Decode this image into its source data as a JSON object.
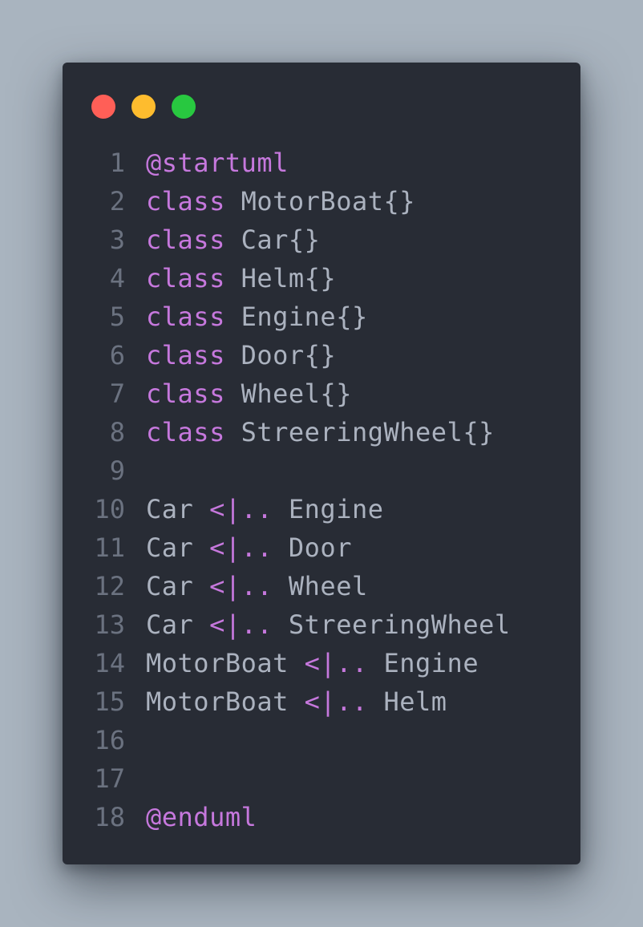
{
  "window": {
    "controls": {
      "close_color": "#ff5f57",
      "minimize_color": "#febc2e",
      "maximize_color": "#28c840"
    }
  },
  "theme": {
    "background": "#282c35",
    "keyword_color": "#c678dd",
    "identifier_color": "#abb2bf",
    "line_number_color": "#6b7280"
  },
  "code": {
    "lines": [
      {
        "number": "1",
        "tokens": [
          {
            "t": "@startuml",
            "c": "kw"
          }
        ]
      },
      {
        "number": "2",
        "tokens": [
          {
            "t": "class",
            "c": "kw"
          },
          {
            "t": " MotorBoat{}",
            "c": "id"
          }
        ]
      },
      {
        "number": "3",
        "tokens": [
          {
            "t": "class",
            "c": "kw"
          },
          {
            "t": " Car{}",
            "c": "id"
          }
        ]
      },
      {
        "number": "4",
        "tokens": [
          {
            "t": "class",
            "c": "kw"
          },
          {
            "t": " Helm{}",
            "c": "id"
          }
        ]
      },
      {
        "number": "5",
        "tokens": [
          {
            "t": "class",
            "c": "kw"
          },
          {
            "t": " Engine{}",
            "c": "id"
          }
        ]
      },
      {
        "number": "6",
        "tokens": [
          {
            "t": "class",
            "c": "kw"
          },
          {
            "t": " Door{}",
            "c": "id"
          }
        ]
      },
      {
        "number": "7",
        "tokens": [
          {
            "t": "class",
            "c": "kw"
          },
          {
            "t": " Wheel{}",
            "c": "id"
          }
        ]
      },
      {
        "number": "8",
        "tokens": [
          {
            "t": "class",
            "c": "kw"
          },
          {
            "t": " StreeringWheel{}",
            "c": "id"
          }
        ]
      },
      {
        "number": "9",
        "tokens": []
      },
      {
        "number": "10",
        "tokens": [
          {
            "t": "Car ",
            "c": "id"
          },
          {
            "t": "<|..",
            "c": "op"
          },
          {
            "t": " Engine",
            "c": "id"
          }
        ]
      },
      {
        "number": "11",
        "tokens": [
          {
            "t": "Car ",
            "c": "id"
          },
          {
            "t": "<|..",
            "c": "op"
          },
          {
            "t": " Door",
            "c": "id"
          }
        ]
      },
      {
        "number": "12",
        "tokens": [
          {
            "t": "Car ",
            "c": "id"
          },
          {
            "t": "<|..",
            "c": "op"
          },
          {
            "t": " Wheel",
            "c": "id"
          }
        ]
      },
      {
        "number": "13",
        "tokens": [
          {
            "t": "Car ",
            "c": "id"
          },
          {
            "t": "<|..",
            "c": "op"
          },
          {
            "t": " StreeringWheel",
            "c": "id"
          }
        ]
      },
      {
        "number": "14",
        "tokens": [
          {
            "t": "MotorBoat ",
            "c": "id"
          },
          {
            "t": "<|..",
            "c": "op"
          },
          {
            "t": " Engine",
            "c": "id"
          }
        ]
      },
      {
        "number": "15",
        "tokens": [
          {
            "t": "MotorBoat ",
            "c": "id"
          },
          {
            "t": "<|..",
            "c": "op"
          },
          {
            "t": " Helm",
            "c": "id"
          }
        ]
      },
      {
        "number": "16",
        "tokens": []
      },
      {
        "number": "17",
        "tokens": []
      },
      {
        "number": "18",
        "tokens": [
          {
            "t": "@enduml",
            "c": "kw"
          }
        ]
      }
    ]
  }
}
